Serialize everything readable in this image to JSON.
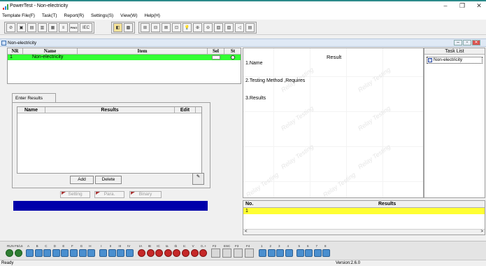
{
  "window": {
    "title": "PowerTest - Non-electricity",
    "controls": [
      "–",
      "❐",
      "✕"
    ]
  },
  "menu": [
    "Template File(F)",
    "Task(T)",
    "Report(R)",
    "Settings(S)",
    "View(W)",
    "Help(H)"
  ],
  "toolbar": {
    "iec_label": "IEC",
    "ping_label": "PING"
  },
  "document_tab": {
    "label": "Non-electricity"
  },
  "item_grid": {
    "columns": [
      "NR",
      "Name",
      "Item",
      "Sel",
      "St"
    ],
    "rows": [
      {
        "nr": "1",
        "name": "Non-electricity",
        "item": "",
        "sel": "",
        "st": ""
      }
    ]
  },
  "enter_results": {
    "tab_label": "Enter Results",
    "columns": [
      "Name",
      "Results",
      "Edit"
    ],
    "add_label": "Add",
    "delete_label": "Delete"
  },
  "mode_buttons": [
    "Setting",
    "Para.",
    "Binary"
  ],
  "result_pane": {
    "title": "Result",
    "sections": [
      "1.Name",
      "2.Testing Method ,Requires",
      "3.Results"
    ],
    "watermark": "Relay Testing"
  },
  "task_list": {
    "title": "Task List",
    "items": [
      {
        "label": "Non-electricity",
        "checked": true
      }
    ]
  },
  "results_table": {
    "columns": [
      "No.",
      "Results"
    ],
    "rows": [
      {
        "no": "1",
        "result": ""
      }
    ]
  },
  "bottom_bar": {
    "run_label": "RUN F5/L6",
    "channel_letters": [
      "A",
      "B",
      "C",
      "D",
      "E",
      "F",
      "G",
      "H",
      "I",
      "II",
      "III",
      "IV",
      "IA",
      "IB",
      "IC",
      "Ia",
      "Ib",
      "Ic",
      "V",
      "0..+"
    ],
    "function_keys": [
      "F2",
      "ESC",
      "F3",
      "F4"
    ],
    "numbers": [
      "1",
      "2",
      "3",
      "4",
      "5",
      "6",
      "7",
      "8"
    ]
  },
  "status": {
    "left": "Ready",
    "version": "Version:2.6.0"
  },
  "colors": {
    "grid_row": "#33ff33",
    "results_row": "#ffff33",
    "blue_bar": "#0000aa"
  }
}
